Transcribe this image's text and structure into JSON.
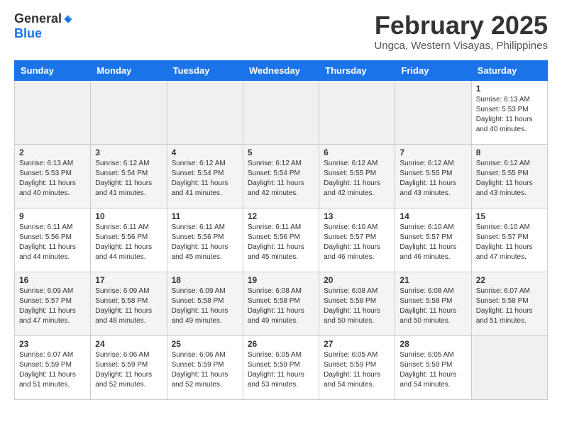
{
  "logo": {
    "general": "General",
    "blue": "Blue"
  },
  "header": {
    "month_title": "February 2025",
    "subtitle": "Ungca, Western Visayas, Philippines"
  },
  "weekdays": [
    "Sunday",
    "Monday",
    "Tuesday",
    "Wednesday",
    "Thursday",
    "Friday",
    "Saturday"
  ],
  "weeks": [
    [
      {
        "day": "",
        "sunrise": "",
        "sunset": "",
        "daylight": ""
      },
      {
        "day": "",
        "sunrise": "",
        "sunset": "",
        "daylight": ""
      },
      {
        "day": "",
        "sunrise": "",
        "sunset": "",
        "daylight": ""
      },
      {
        "day": "",
        "sunrise": "",
        "sunset": "",
        "daylight": ""
      },
      {
        "day": "",
        "sunrise": "",
        "sunset": "",
        "daylight": ""
      },
      {
        "day": "",
        "sunrise": "",
        "sunset": "",
        "daylight": ""
      },
      {
        "day": "1",
        "sunrise": "Sunrise: 6:13 AM",
        "sunset": "Sunset: 5:53 PM",
        "daylight": "Daylight: 11 hours and 40 minutes."
      }
    ],
    [
      {
        "day": "2",
        "sunrise": "Sunrise: 6:13 AM",
        "sunset": "Sunset: 5:53 PM",
        "daylight": "Daylight: 11 hours and 40 minutes."
      },
      {
        "day": "3",
        "sunrise": "Sunrise: 6:12 AM",
        "sunset": "Sunset: 5:54 PM",
        "daylight": "Daylight: 11 hours and 41 minutes."
      },
      {
        "day": "4",
        "sunrise": "Sunrise: 6:12 AM",
        "sunset": "Sunset: 5:54 PM",
        "daylight": "Daylight: 11 hours and 41 minutes."
      },
      {
        "day": "5",
        "sunrise": "Sunrise: 6:12 AM",
        "sunset": "Sunset: 5:54 PM",
        "daylight": "Daylight: 11 hours and 42 minutes."
      },
      {
        "day": "6",
        "sunrise": "Sunrise: 6:12 AM",
        "sunset": "Sunset: 5:55 PM",
        "daylight": "Daylight: 11 hours and 42 minutes."
      },
      {
        "day": "7",
        "sunrise": "Sunrise: 6:12 AM",
        "sunset": "Sunset: 5:55 PM",
        "daylight": "Daylight: 11 hours and 43 minutes."
      },
      {
        "day": "8",
        "sunrise": "Sunrise: 6:12 AM",
        "sunset": "Sunset: 5:55 PM",
        "daylight": "Daylight: 11 hours and 43 minutes."
      }
    ],
    [
      {
        "day": "9",
        "sunrise": "Sunrise: 6:11 AM",
        "sunset": "Sunset: 5:56 PM",
        "daylight": "Daylight: 11 hours and 44 minutes."
      },
      {
        "day": "10",
        "sunrise": "Sunrise: 6:11 AM",
        "sunset": "Sunset: 5:56 PM",
        "daylight": "Daylight: 11 hours and 44 minutes."
      },
      {
        "day": "11",
        "sunrise": "Sunrise: 6:11 AM",
        "sunset": "Sunset: 5:56 PM",
        "daylight": "Daylight: 11 hours and 45 minutes."
      },
      {
        "day": "12",
        "sunrise": "Sunrise: 6:11 AM",
        "sunset": "Sunset: 5:56 PM",
        "daylight": "Daylight: 11 hours and 45 minutes."
      },
      {
        "day": "13",
        "sunrise": "Sunrise: 6:10 AM",
        "sunset": "Sunset: 5:57 PM",
        "daylight": "Daylight: 11 hours and 46 minutes."
      },
      {
        "day": "14",
        "sunrise": "Sunrise: 6:10 AM",
        "sunset": "Sunset: 5:57 PM",
        "daylight": "Daylight: 11 hours and 46 minutes."
      },
      {
        "day": "15",
        "sunrise": "Sunrise: 6:10 AM",
        "sunset": "Sunset: 5:57 PM",
        "daylight": "Daylight: 11 hours and 47 minutes."
      }
    ],
    [
      {
        "day": "16",
        "sunrise": "Sunrise: 6:09 AM",
        "sunset": "Sunset: 5:57 PM",
        "daylight": "Daylight: 11 hours and 47 minutes."
      },
      {
        "day": "17",
        "sunrise": "Sunrise: 6:09 AM",
        "sunset": "Sunset: 5:58 PM",
        "daylight": "Daylight: 11 hours and 48 minutes."
      },
      {
        "day": "18",
        "sunrise": "Sunrise: 6:09 AM",
        "sunset": "Sunset: 5:58 PM",
        "daylight": "Daylight: 11 hours and 49 minutes."
      },
      {
        "day": "19",
        "sunrise": "Sunrise: 6:08 AM",
        "sunset": "Sunset: 5:58 PM",
        "daylight": "Daylight: 11 hours and 49 minutes."
      },
      {
        "day": "20",
        "sunrise": "Sunrise: 6:08 AM",
        "sunset": "Sunset: 5:58 PM",
        "daylight": "Daylight: 11 hours and 50 minutes."
      },
      {
        "day": "21",
        "sunrise": "Sunrise: 6:08 AM",
        "sunset": "Sunset: 5:58 PM",
        "daylight": "Daylight: 11 hours and 50 minutes."
      },
      {
        "day": "22",
        "sunrise": "Sunrise: 6:07 AM",
        "sunset": "Sunset: 5:58 PM",
        "daylight": "Daylight: 11 hours and 51 minutes."
      }
    ],
    [
      {
        "day": "23",
        "sunrise": "Sunrise: 6:07 AM",
        "sunset": "Sunset: 5:59 PM",
        "daylight": "Daylight: 11 hours and 51 minutes."
      },
      {
        "day": "24",
        "sunrise": "Sunrise: 6:06 AM",
        "sunset": "Sunset: 5:59 PM",
        "daylight": "Daylight: 11 hours and 52 minutes."
      },
      {
        "day": "25",
        "sunrise": "Sunrise: 6:06 AM",
        "sunset": "Sunset: 5:59 PM",
        "daylight": "Daylight: 11 hours and 52 minutes."
      },
      {
        "day": "26",
        "sunrise": "Sunrise: 6:05 AM",
        "sunset": "Sunset: 5:59 PM",
        "daylight": "Daylight: 11 hours and 53 minutes."
      },
      {
        "day": "27",
        "sunrise": "Sunrise: 6:05 AM",
        "sunset": "Sunset: 5:59 PM",
        "daylight": "Daylight: 11 hours and 54 minutes."
      },
      {
        "day": "28",
        "sunrise": "Sunrise: 6:05 AM",
        "sunset": "Sunset: 5:59 PM",
        "daylight": "Daylight: 11 hours and 54 minutes."
      },
      {
        "day": "",
        "sunrise": "",
        "sunset": "",
        "daylight": ""
      }
    ]
  ]
}
